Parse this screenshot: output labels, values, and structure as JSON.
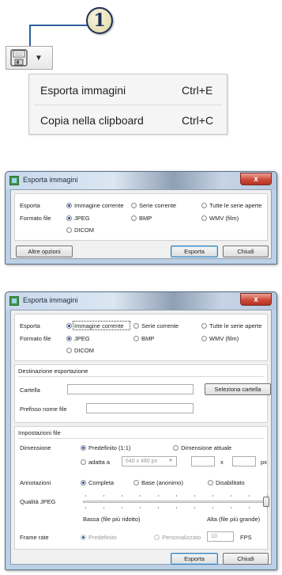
{
  "callout": {
    "number": "1"
  },
  "save_menu": {
    "items": [
      {
        "label": "Esporta immagini",
        "shortcut": "Ctrl+E"
      },
      {
        "label": "Copia nella clipboard",
        "shortcut": "Ctrl+C"
      }
    ]
  },
  "dialog_small": {
    "title": "Esporta immagini",
    "close": "x",
    "esporta_label": "Esporta",
    "esporta_options": [
      "Immagine corrente",
      "Serie corrente",
      "Tutte le serie aperte"
    ],
    "esporta_selected": "Immagine corrente",
    "formato_label": "Formato file",
    "formato_options": [
      "JPEG",
      "BMP",
      "WMV (film)",
      "DICOM"
    ],
    "formato_selected": "JPEG",
    "altre_opzioni": "Altre opzioni",
    "esporta_button": "Esporta",
    "chiudi_button": "Chiudi"
  },
  "dialog_large": {
    "title": "Esporta immagini",
    "close": "x",
    "esporta_label": "Esporta",
    "esporta_options": [
      "Immagine corrente",
      "Serie corrente",
      "Tutte le serie aperte"
    ],
    "esporta_selected": "Immagine corrente",
    "formato_label": "Formato file",
    "formato_options": [
      "JPEG",
      "BMP",
      "WMV (film)",
      "DICOM"
    ],
    "formato_selected": "JPEG",
    "destinazione": {
      "title": "Destinazione esportazione",
      "cartella_label": "Cartella",
      "cartella_value": "",
      "seleziona_button": "Seleziona cartella",
      "prefisso_label": "Prefisso nome file",
      "prefisso_value": ""
    },
    "impostazioni": {
      "title": "Impostazioni file",
      "dimensione_label": "Dimensione",
      "dimensione_options": [
        "Predefinito (1:1)",
        "Dimensione attuale",
        "adatta a"
      ],
      "dimensione_selected": "Predefinito (1:1)",
      "size_preset": "640 x 480 px",
      "size_x_sep": "x",
      "size_unit": "px",
      "annotazioni_label": "Annotazioni",
      "annotazioni_options": [
        "Completa",
        "Base (anonimo)",
        "Disabilitato"
      ],
      "annotazioni_selected": "Completa",
      "qualita_label": "Qualità JPEG",
      "qualita_low": "Bassa (file più ridotto)",
      "qualita_high": "Alta (file più grande)",
      "qualita_level": 1.0,
      "frame_rate_label": "Frame rate",
      "frame_rate_options": [
        "Predefinito",
        "Personalizzato"
      ],
      "frame_rate_value": "10",
      "frame_rate_unit": "FPS"
    },
    "esporta_button": "Esporta",
    "chiudi_button": "Chiudi"
  }
}
